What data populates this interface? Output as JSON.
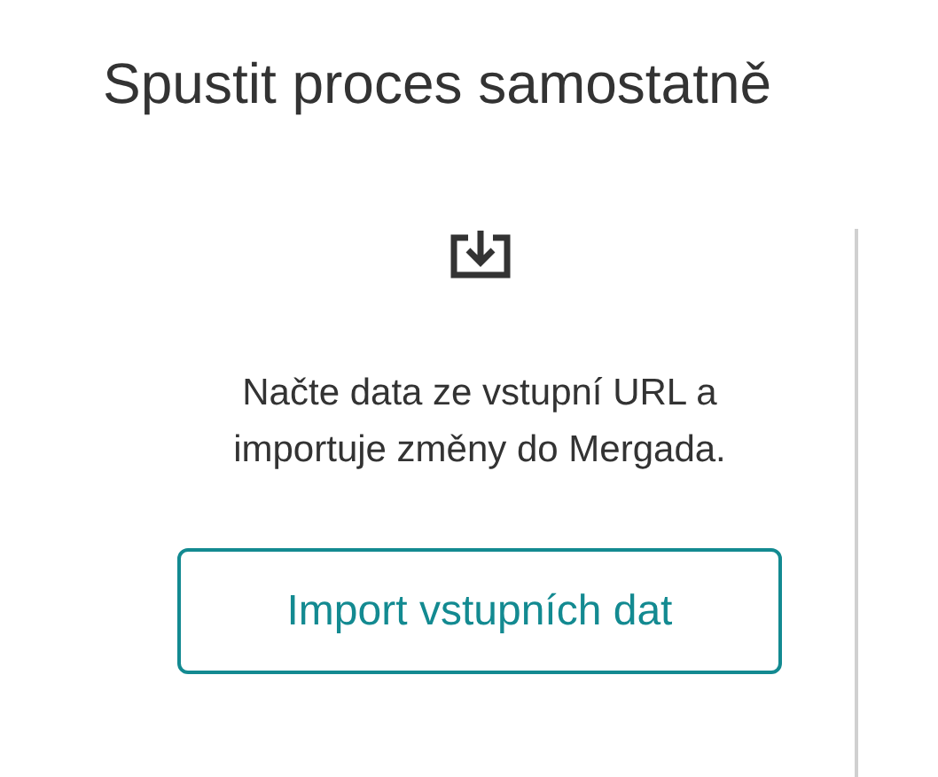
{
  "title": "Spustit proces samostatně",
  "process": {
    "description": "Načte data ze vstupní URL a importuje změny do Mergada.",
    "button": "Import vstupních dat"
  }
}
